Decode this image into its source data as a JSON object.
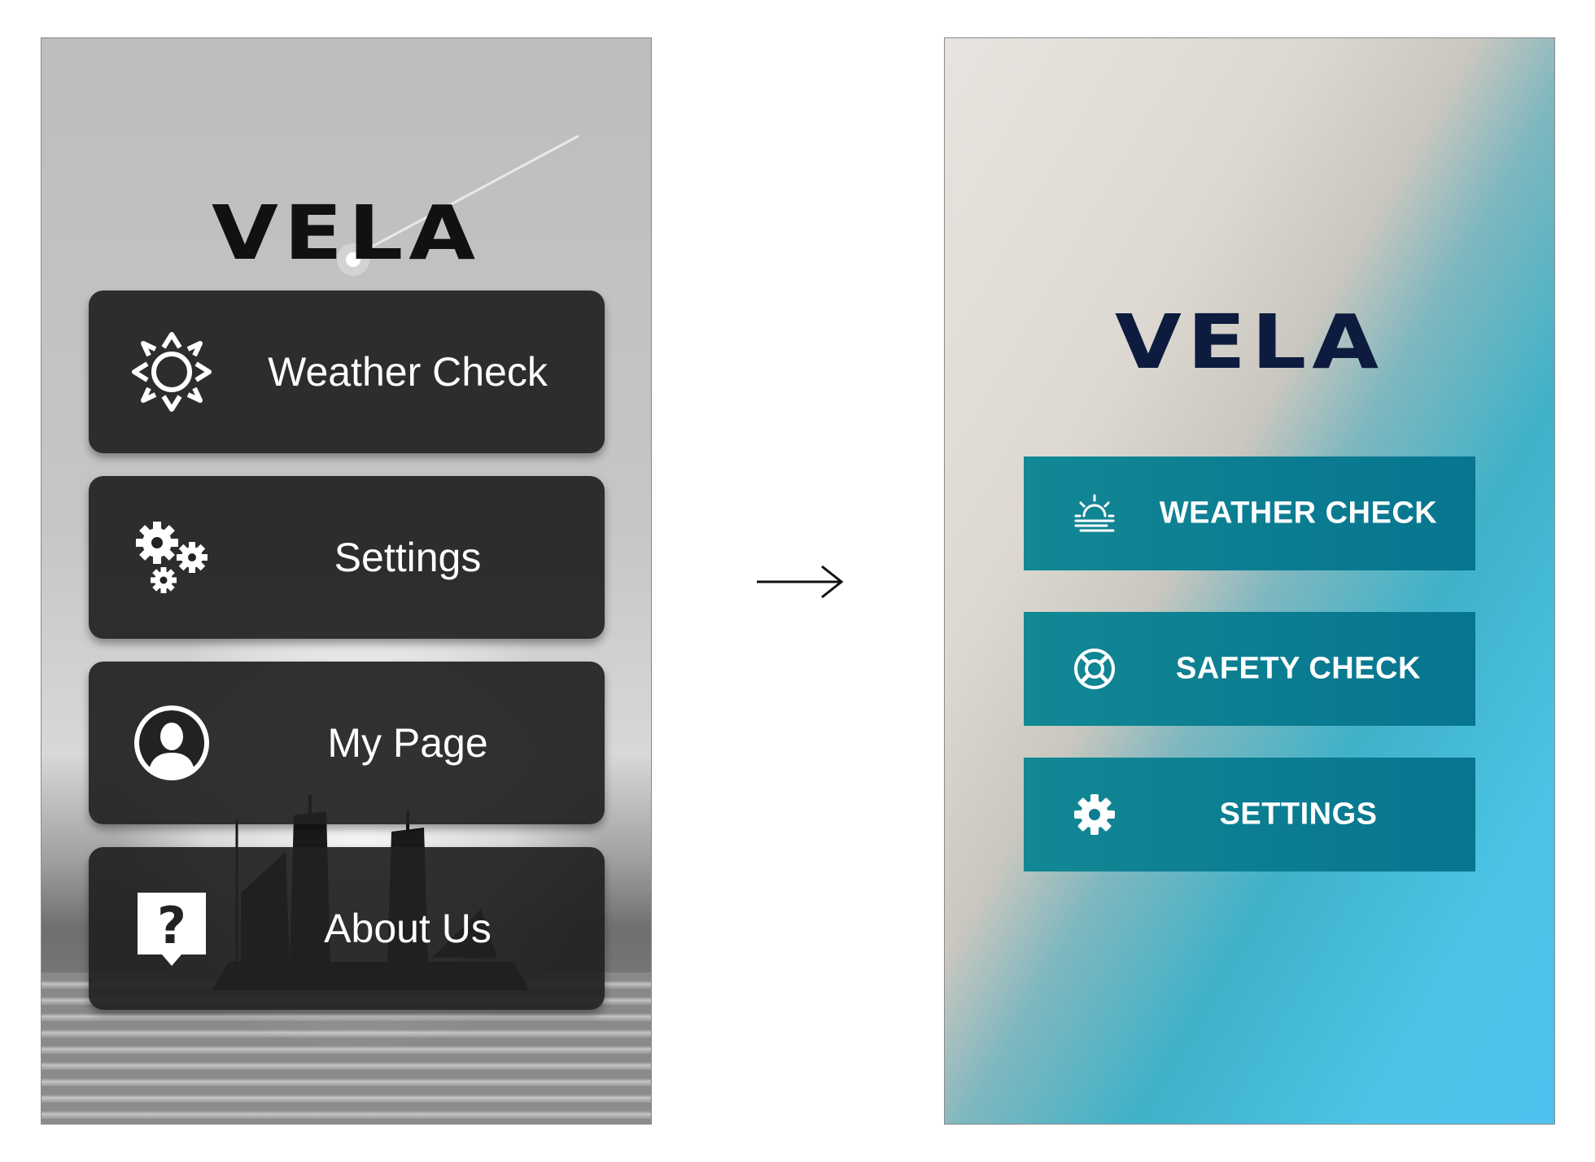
{
  "old_screen": {
    "logo": "VELA",
    "buttons": [
      {
        "label": "Weather Check",
        "icon": "sun-icon"
      },
      {
        "label": "Settings",
        "icon": "gears-icon"
      },
      {
        "label": "My Page",
        "icon": "user-icon"
      },
      {
        "label": "About Us",
        "icon": "question-icon"
      }
    ]
  },
  "arrow": "→",
  "new_screen": {
    "logo": "VELA",
    "buttons": [
      {
        "label": "WEATHER CHECK",
        "icon": "weather-icon"
      },
      {
        "label": "SAFETY CHECK",
        "icon": "lifebuoy-icon"
      },
      {
        "label": "SETTINGS",
        "icon": "gear-icon"
      }
    ]
  },
  "colors": {
    "old_button": "#212121",
    "new_button": "#0b7d92",
    "new_logo": "#0d1b3e"
  }
}
